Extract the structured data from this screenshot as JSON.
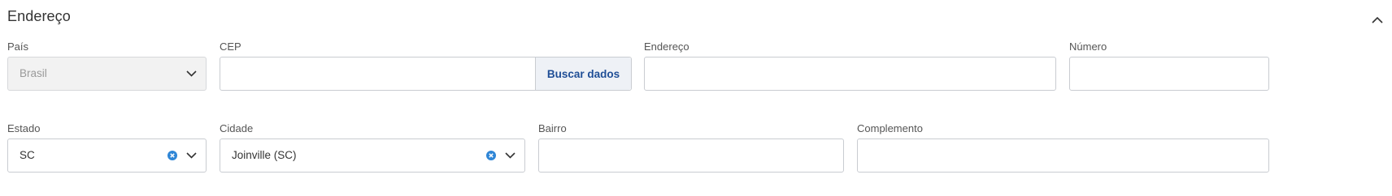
{
  "section": {
    "title": "Endereço",
    "icon": "chevron-up-icon"
  },
  "fields": {
    "pais": {
      "label": "País",
      "value": "Brasil",
      "disabled": true
    },
    "cep": {
      "label": "CEP",
      "value": "",
      "button_label": "Buscar dados"
    },
    "endereco": {
      "label": "Endereço",
      "value": ""
    },
    "numero": {
      "label": "Número",
      "value": ""
    },
    "estado": {
      "label": "Estado",
      "value": "SC"
    },
    "cidade": {
      "label": "Cidade",
      "value": "Joinville (SC)"
    },
    "bairro": {
      "label": "Bairro",
      "value": ""
    },
    "complemento": {
      "label": "Complemento",
      "value": ""
    }
  },
  "colors": {
    "accent": "#1f4e96",
    "clear_icon": "#2f86d6",
    "border": "#c9ccd1",
    "disabled_bg": "#f2f2f2"
  }
}
